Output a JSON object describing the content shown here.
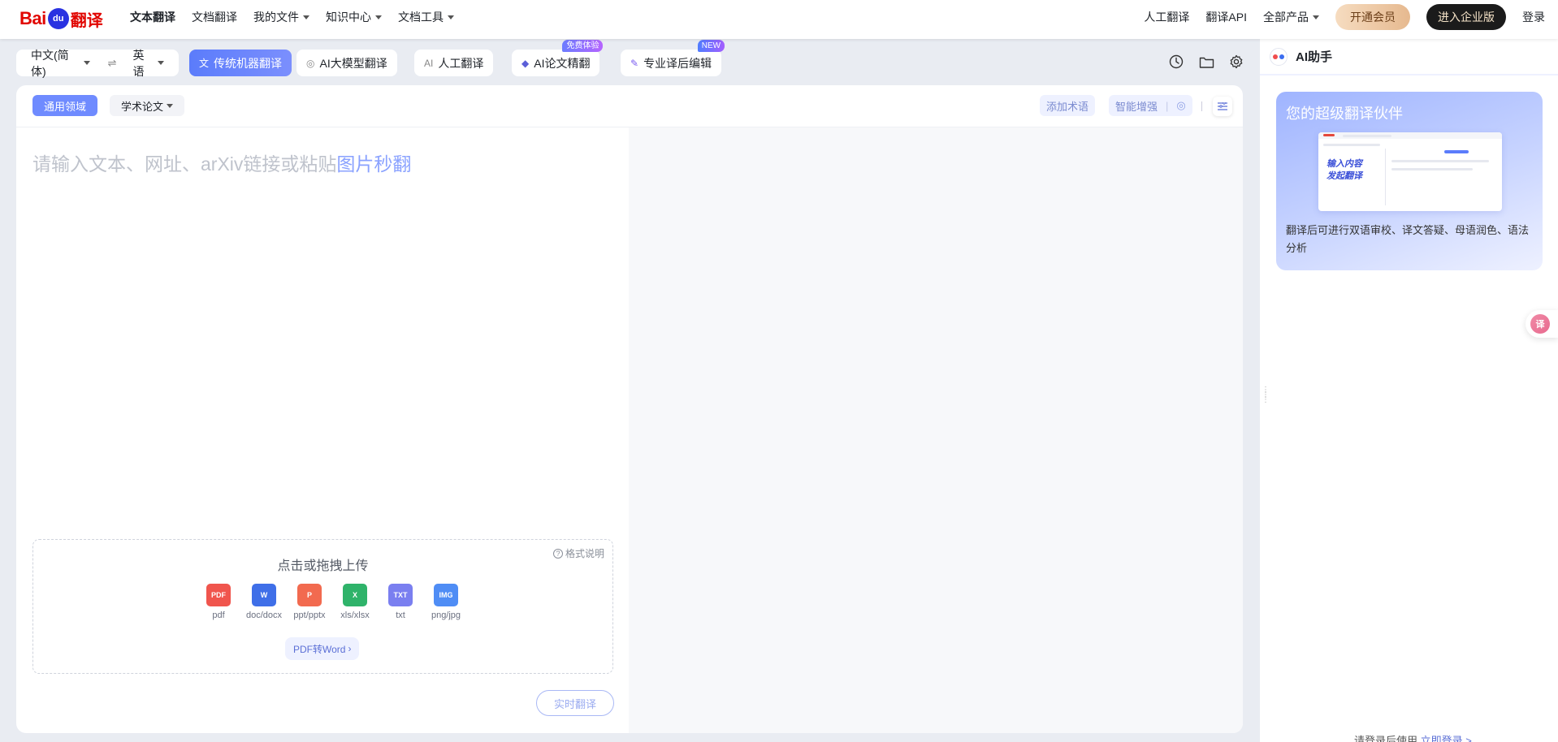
{
  "logo": {
    "part1": "Bai",
    "paw": "du",
    "part2": "翻译"
  },
  "nav": {
    "left": [
      "文本翻译",
      "文档翻译",
      "我的文件",
      "知识中心",
      "文档工具"
    ],
    "right": [
      "人工翻译",
      "翻译API",
      "全部产品"
    ],
    "vip": "开通会员",
    "enterprise": "进入企业版",
    "login": "登录"
  },
  "lang": {
    "source": "中文(简体)",
    "swap": "⇌",
    "target": "英语"
  },
  "modes": {
    "traditional": "传统机器翻译",
    "ai_model": "AI大模型翻译",
    "human": "人工翻译",
    "paper": "AI论文精翻",
    "paper_badge": "免费体验",
    "post_edit": "专业译后编辑",
    "post_edit_badge": "NEW"
  },
  "domain": {
    "general": "通用领域",
    "academic": "学术论文",
    "add_term": "添加术语",
    "smart": "智能增强"
  },
  "editor": {
    "placeholder": "请输入文本、网址、arXiv链接或粘贴",
    "placeholder_link": "图片秒翻"
  },
  "upload": {
    "title": "点击或拖拽上传",
    "format_help": "格式说明",
    "types": [
      {
        "label": "pdf",
        "color": "#f0554d",
        "icon_text": "PDF"
      },
      {
        "label": "doc/docx",
        "color": "#3f6fe8",
        "icon_text": "W"
      },
      {
        "label": "ppt/pptx",
        "color": "#f26a4f",
        "icon_text": "P"
      },
      {
        "label": "xls/xlsx",
        "color": "#2fb36a",
        "icon_text": "X"
      },
      {
        "label": "txt",
        "color": "#7a7ff0",
        "icon_text": "TXT"
      },
      {
        "label": "png/jpg",
        "color": "#4f8df5",
        "icon_text": "IMG"
      }
    ],
    "pdf_to_word": "PDF转Word"
  },
  "realtime_button": "实时翻译",
  "ai": {
    "title": "AI助手",
    "card_title": "您的超级翻译伙伴",
    "card_image_text": "输入内容\n发起翻译",
    "card_desc": "翻译后可进行双语审校、译文答疑、母语润色、语法分析",
    "login_tip": "请登录后使用",
    "login_link": "立即登录 >"
  },
  "float_button": "译",
  "colors": {
    "accent": "#5b7cfb",
    "brand_red": "#e10601"
  }
}
